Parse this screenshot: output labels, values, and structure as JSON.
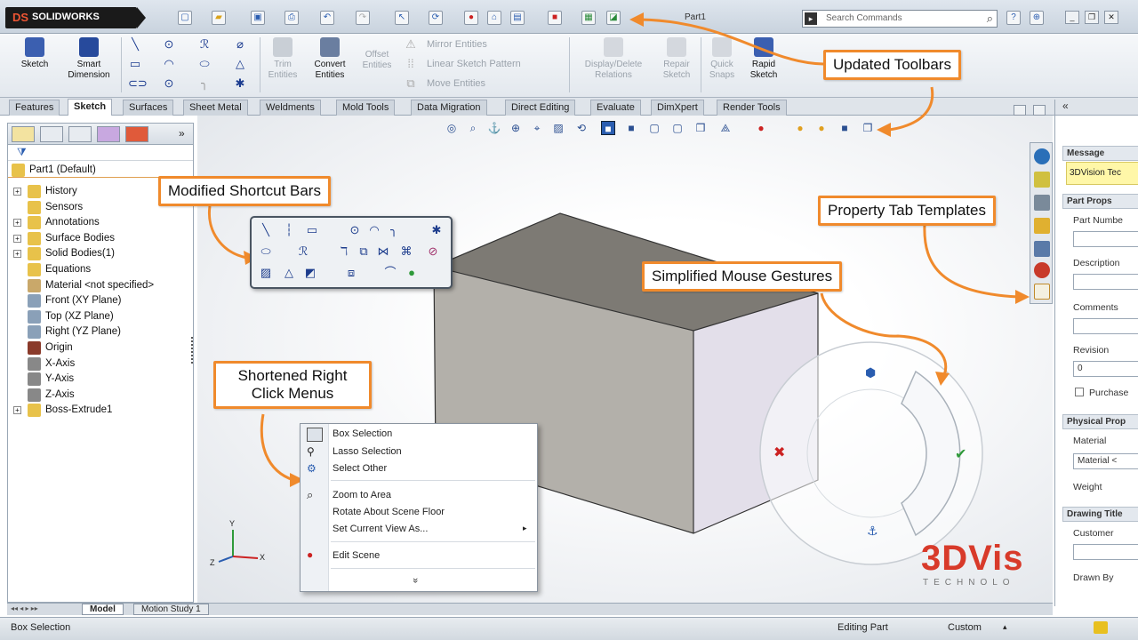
{
  "app": {
    "brand": "SOLIDWORKS",
    "brand_mark": "DS",
    "document_title": "Part1",
    "search_placeholder": "Search Commands"
  },
  "command_manager": {
    "buttons": [
      {
        "label": "Sketch",
        "enabled": true
      },
      {
        "label": "Smart Dimension",
        "enabled": true
      },
      {
        "label": "Trim Entities",
        "enabled": false
      },
      {
        "label": "Convert Entities",
        "enabled": true
      },
      {
        "label": "Offset Entities",
        "enabled": false
      },
      {
        "label": "Mirror Entities",
        "enabled": false
      },
      {
        "label": "Linear Sketch Pattern",
        "enabled": false
      },
      {
        "label": "Move Entities",
        "enabled": false
      },
      {
        "label": "Display/Delete Relations",
        "enabled": false
      },
      {
        "label": "Repair Sketch",
        "enabled": false
      },
      {
        "label": "Quick Snaps",
        "enabled": false
      },
      {
        "label": "Rapid Sketch",
        "enabled": true
      }
    ],
    "tabs": [
      "Features",
      "Sketch",
      "Surfaces",
      "Sheet Metal",
      "Weldments",
      "Mold Tools",
      "Data Migration",
      "Direct Editing",
      "Evaluate",
      "DimXpert",
      "Render Tools"
    ],
    "active_tab": "Sketch"
  },
  "feature_tree": {
    "root": "Part1  (Default)",
    "items": [
      {
        "label": "History",
        "expandable": true,
        "icon": "history-icon",
        "color": "#e8c24a"
      },
      {
        "label": "Sensors",
        "expandable": false,
        "icon": "sensor-icon",
        "color": "#e8c24a"
      },
      {
        "label": "Annotations",
        "expandable": true,
        "icon": "annotation-icon",
        "color": "#e8c24a"
      },
      {
        "label": "Surface Bodies",
        "expandable": true,
        "icon": "folder-icon",
        "color": "#e8c24a"
      },
      {
        "label": "Solid Bodies(1)",
        "expandable": true,
        "icon": "folder-icon",
        "color": "#e8c24a"
      },
      {
        "label": "Equations",
        "expandable": false,
        "icon": "equation-icon",
        "color": "#e8c24a"
      },
      {
        "label": "Material <not specified>",
        "expandable": false,
        "icon": "material-icon",
        "color": "#c9a86a"
      },
      {
        "label": "Front (XY Plane)",
        "expandable": false,
        "icon": "plane-icon",
        "color": "#8aa0b8"
      },
      {
        "label": "Top (XZ Plane)",
        "expandable": false,
        "icon": "plane-icon",
        "color": "#8aa0b8"
      },
      {
        "label": "Right (YZ Plane)",
        "expandable": false,
        "icon": "plane-icon",
        "color": "#8aa0b8"
      },
      {
        "label": "Origin",
        "expandable": false,
        "icon": "origin-icon",
        "color": "#8a3a2a"
      },
      {
        "label": "X-Axis",
        "expandable": false,
        "icon": "axis-icon",
        "color": "#888888"
      },
      {
        "label": "Y-Axis",
        "expandable": false,
        "icon": "axis-icon",
        "color": "#888888"
      },
      {
        "label": "Z-Axis",
        "expandable": false,
        "icon": "axis-icon",
        "color": "#888888"
      },
      {
        "label": "Boss-Extrude1",
        "expandable": true,
        "icon": "extrude-icon",
        "color": "#e8c24a"
      }
    ]
  },
  "callouts": {
    "updated_toolbars": "Updated Toolbars",
    "modified_shortcut_bars": "Modified Shortcut Bars",
    "property_tab_templates": "Property Tab Templates",
    "simplified_mouse_gestures": "Simplified Mouse Gestures",
    "shortened_right_click_menus": "Shortened Right Click Menus"
  },
  "context_menu": {
    "items": [
      "Box Selection",
      "Lasso Selection",
      "Select Other",
      "Zoom to Area",
      "Rotate About Scene Floor",
      "Set Current View As...",
      "Edit Scene"
    ],
    "more_glyph": "»"
  },
  "property_panel": {
    "message_header": "Message",
    "message_text": "3DVision Tec",
    "sections": [
      "Part Props",
      "Physical Prop",
      "Drawing Title"
    ],
    "fields": {
      "part_number": "Part Numbe",
      "description": "Description",
      "comments": "Comments",
      "revision": "Revision",
      "revision_value": "0",
      "purchased": "Purchase",
      "material": "Material",
      "material_value": "Material <",
      "weight": "Weight",
      "customer": "Customer",
      "drawn_by": "Drawn By"
    },
    "collapse_glyph": "«"
  },
  "watermark": {
    "text": "3DVis",
    "subtext": "TECHNOLO"
  },
  "model_tabs": [
    "Model",
    "Motion Study 1"
  ],
  "status_bar": {
    "left": "Box Selection",
    "mode": "Editing Part",
    "units": "Custom"
  },
  "triad": {
    "x": "X",
    "y": "Y",
    "z": "Z"
  },
  "colors": {
    "callout_border": "#f08a2c",
    "accent_blue": "#2a5db0",
    "box_top": "#7d7a74",
    "box_front": "#b3b0aa",
    "box_side": "#e3dfea"
  }
}
